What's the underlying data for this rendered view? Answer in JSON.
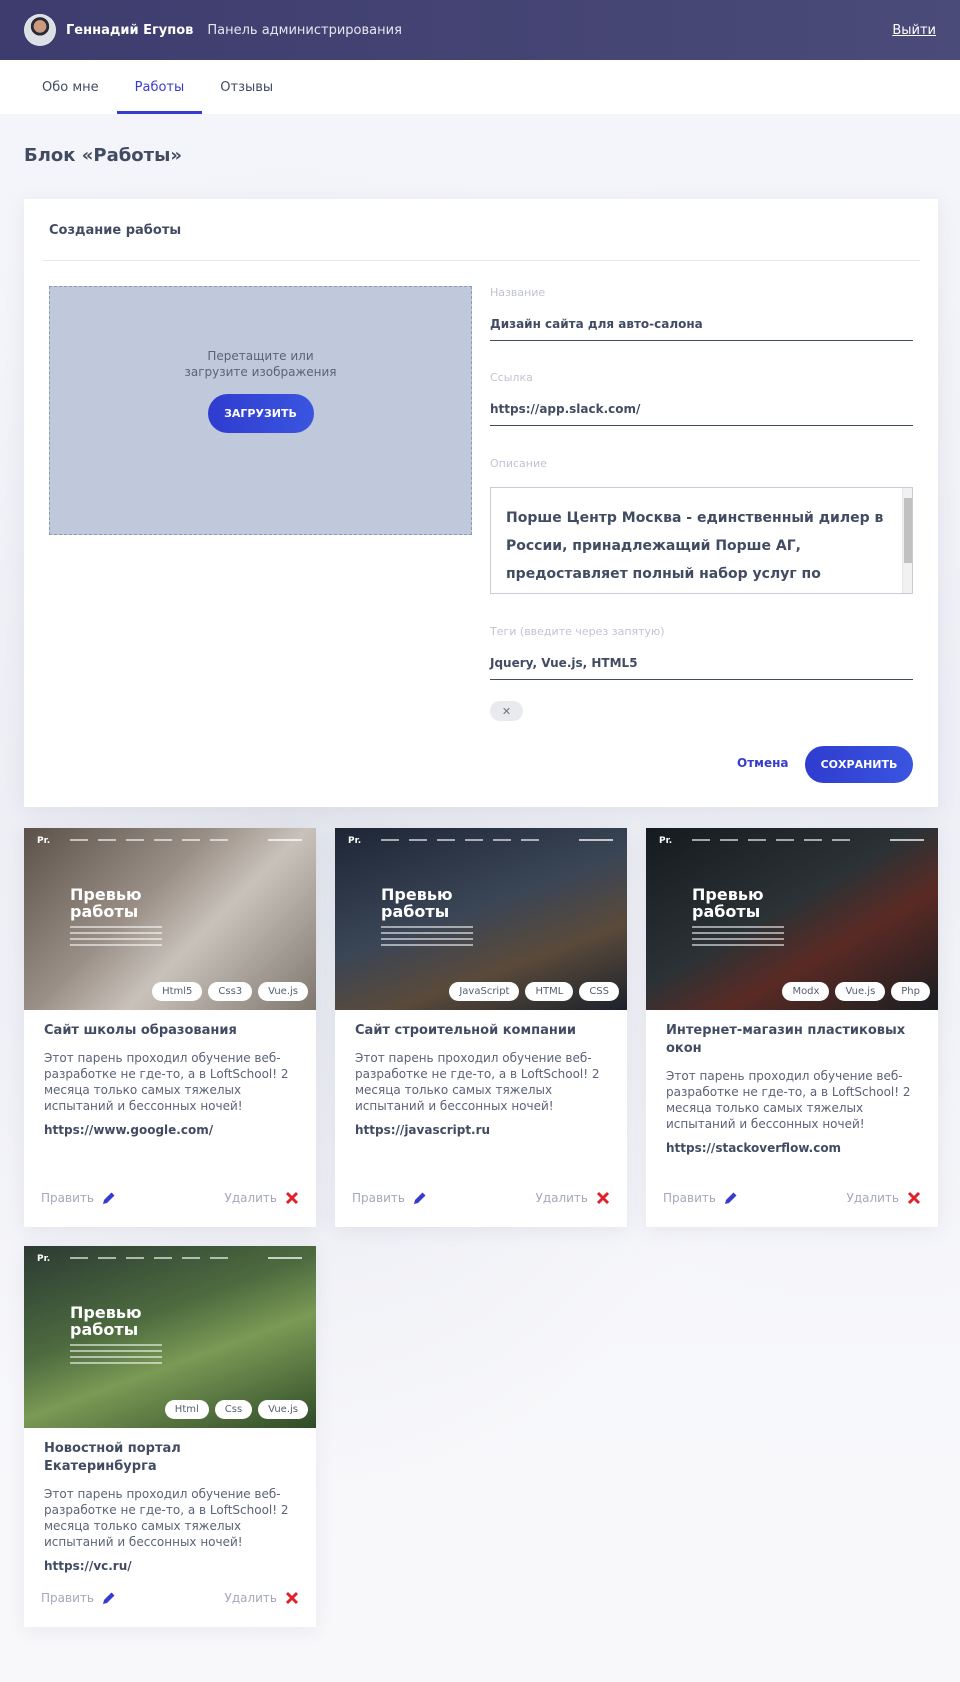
{
  "header": {
    "user_name": "Геннадий Егупов",
    "subtitle": "Панель администрирования",
    "logout": "Выйти"
  },
  "tabs": [
    {
      "label": "Обо мне",
      "active": false
    },
    {
      "label": "Работы",
      "active": true
    },
    {
      "label": "Отзывы",
      "active": false
    }
  ],
  "page_title": "Блок «Работы»",
  "form": {
    "title": "Создание работы",
    "dropzone_text": "Перетащите или загрузите изображения",
    "upload_button": "ЗАГРУЗИТЬ",
    "name_label": "Название",
    "name_value": "Дизайн сайта для авто-салона",
    "link_label": "Ссылка",
    "link_value": "https://app.slack.com/",
    "description_label": "Описание",
    "description_value": "Порше Центр Москва - единственный дилер в России, принадлежащий Порше АГ, предоставляет полный набор услуг по продаже и сервисному",
    "tags_label": "Теги (введите через запятую)",
    "tags_value": "Jquery, Vue.js, HTML5",
    "tag_chip": "✕",
    "cancel_button": "Отмена",
    "save_button": "СОХРАНИТЬ"
  },
  "preview": {
    "logo": "Pr.",
    "title": "Превью работы"
  },
  "actions": {
    "edit": "Править",
    "delete": "Удалить"
  },
  "works": [
    {
      "title": "Сайт школы образования",
      "desc": "Этот парень проходил обучение веб-разработке не где-то, а в LoftSchool! 2 месяца только самых тяжелых испытаний и бессонных ночей!",
      "link": "https://www.google.com/",
      "tags": [
        "Html5",
        "Css3",
        "Vue.js"
      ]
    },
    {
      "title": "Сайт строительной компании",
      "desc": "Этот парень проходил обучение веб-разработке не где-то, а в LoftSchool! 2 месяца только самых тяжелых испытаний и бессонных ночей!",
      "link": "https://javascript.ru",
      "tags": [
        "JavaScript",
        "HTML",
        "CSS"
      ]
    },
    {
      "title": "Интернет-магазин пластиковых окон",
      "desc": "Этот парень проходил обучение веб-разработке не где-то, а в LoftSchool! 2 месяца только самых тяжелых испытаний и бессонных ночей!",
      "link": "https://stackoverflow.com",
      "tags": [
        "Modx",
        "Vue.js",
        "Php"
      ]
    },
    {
      "title": "Новостной портал Екатеринбурга",
      "desc": "Этот парень проходил обучение веб-разработке не где-то, а в LoftSchool! 2 месяца только самых тяжелых испытаний и бессонных ночей!",
      "link": "https://vc.ru/",
      "tags": [
        "Html",
        "Css",
        "Vue.js"
      ]
    }
  ],
  "colors": {
    "accent": "#383bcf",
    "header_bg": "#3e3c6e",
    "delete": "#e0212b"
  }
}
